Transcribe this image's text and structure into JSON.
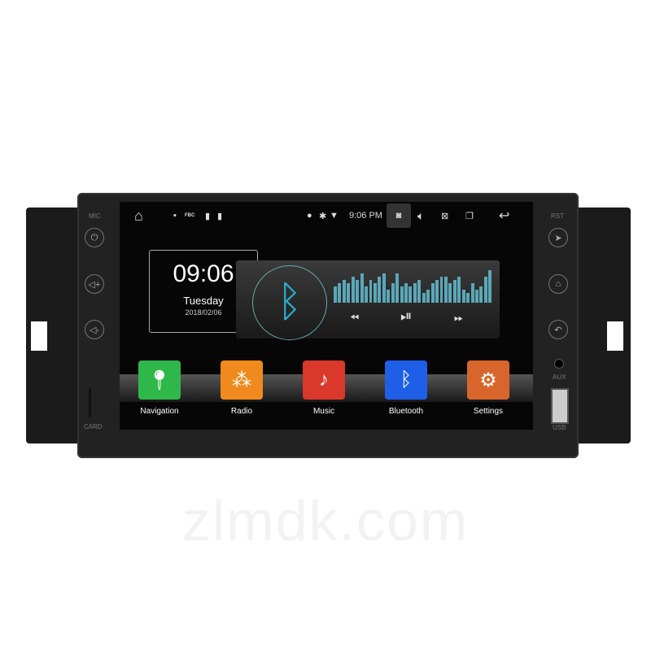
{
  "bezel": {
    "mic": "MIC",
    "card": "CARD",
    "rst": "RST",
    "aux": "AUX",
    "usb": "USB"
  },
  "status_bar": {
    "time": "9:06 PM",
    "icons": [
      "home-icon",
      "image-icon",
      "fm-icon",
      "sd-icon",
      "sd-icon",
      "location-icon",
      "bluetooth-icon",
      "wifi-icon",
      "camera-icon",
      "volume-icon",
      "close-box-icon",
      "recent-apps-icon",
      "back-icon"
    ],
    "fm_text": "FBC"
  },
  "clock_widget": {
    "time": "09:06",
    "day": "Tuesday",
    "date": "2018/02/06"
  },
  "player": {
    "eq_levels": [
      0.5,
      0.6,
      0.7,
      0.6,
      0.8,
      0.7,
      0.9,
      0.5,
      0.7,
      0.6,
      0.8,
      0.9,
      0.4,
      0.6,
      0.9,
      0.5,
      0.6,
      0.5,
      0.6,
      0.7,
      0.3,
      0.4,
      0.6,
      0.7,
      0.8,
      0.8,
      0.6,
      0.7,
      0.8,
      0.4,
      0.3,
      0.6,
      0.4,
      0.5,
      0.8,
      1.0
    ]
  },
  "apps": [
    {
      "label": "Navigation",
      "color": "#2fb84a",
      "icon": "map-pin-icon"
    },
    {
      "label": "Radio",
      "color": "#f08a1c",
      "icon": "radio-icon"
    },
    {
      "label": "Music",
      "color": "#d9382b",
      "icon": "music-icon"
    },
    {
      "label": "Bluetooth",
      "color": "#1f5fe8",
      "icon": "bluetooth-icon"
    },
    {
      "label": "Settings",
      "color": "#d8662c",
      "icon": "settings-icon"
    }
  ],
  "watermark": "zlmdk.com"
}
